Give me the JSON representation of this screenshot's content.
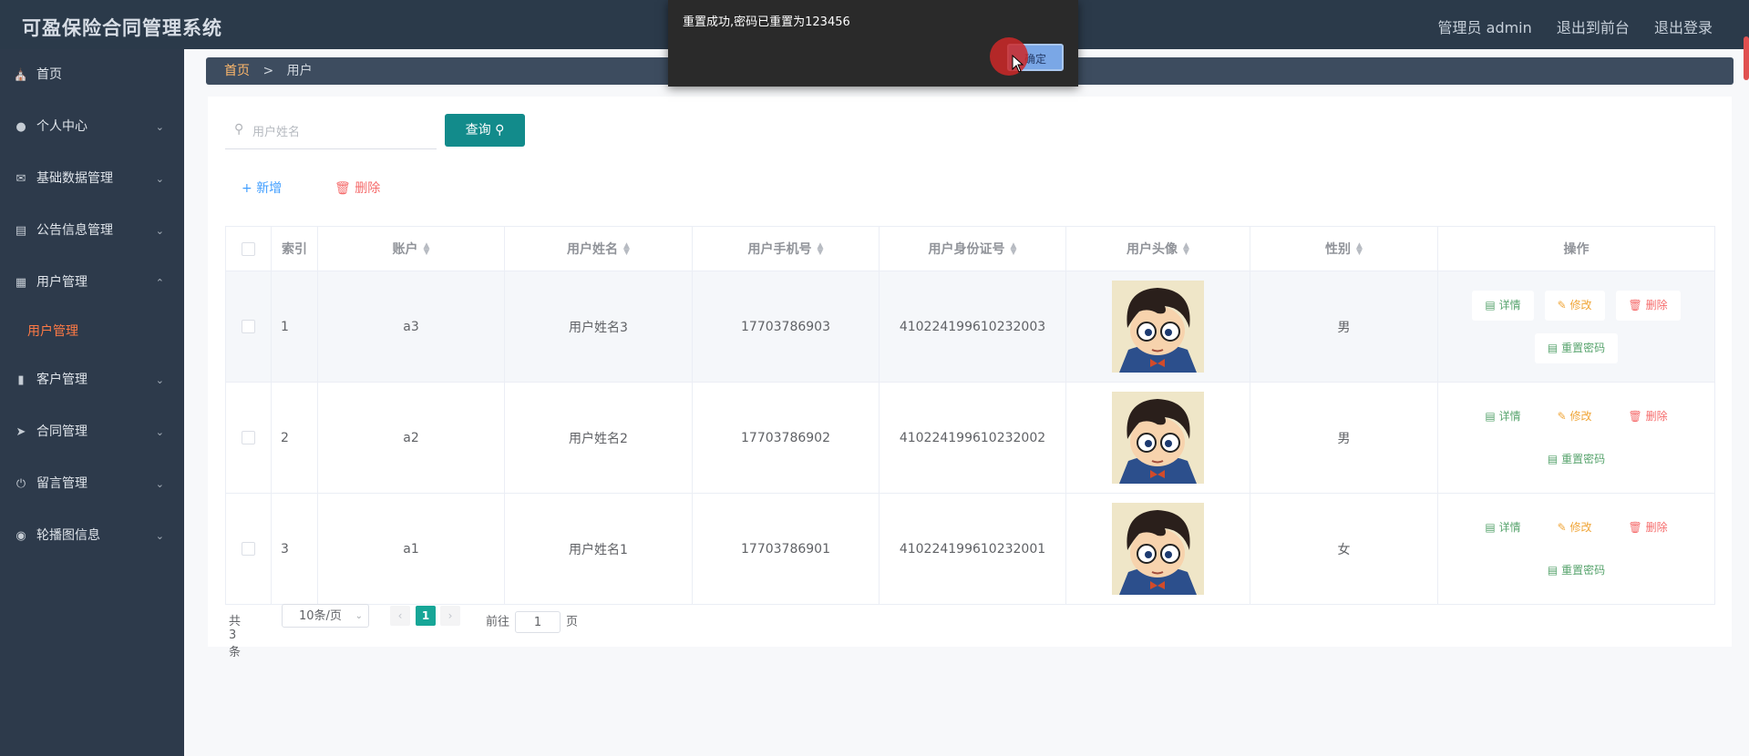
{
  "app": {
    "title": "可盈保险合同管理系统"
  },
  "topbar": {
    "user": "管理员 admin",
    "front": "退出到前台",
    "logout": "退出登录"
  },
  "sidebar": {
    "items": [
      {
        "label": "首页",
        "icon": "home-icon"
      },
      {
        "label": "个人中心",
        "icon": "user-icon"
      },
      {
        "label": "基础数据管理",
        "icon": "mail-icon"
      },
      {
        "label": "公告信息管理",
        "icon": "clipboard-icon"
      },
      {
        "label": "用户管理",
        "icon": "chart-icon",
        "expanded": true
      },
      {
        "label": "客户管理",
        "icon": "stamp-icon"
      },
      {
        "label": "合同管理",
        "icon": "send-icon"
      },
      {
        "label": "留言管理",
        "icon": "power-icon"
      },
      {
        "label": "轮播图信息",
        "icon": "location-icon"
      }
    ],
    "sub_item": "用户管理"
  },
  "breadcrumb": {
    "home": "首页",
    "separator": ">",
    "current": "用户"
  },
  "search": {
    "placeholder": "用户姓名",
    "value": "",
    "button": "查询"
  },
  "actions": {
    "add": "新增",
    "delete": "删除"
  },
  "table": {
    "columns": [
      "索引",
      "账户",
      "用户姓名",
      "用户手机号",
      "用户身份证号",
      "用户头像",
      "性别",
      "操作"
    ],
    "rows": [
      {
        "index": "1",
        "account": "a3",
        "name": "用户姓名3",
        "phone": "17703786903",
        "id_card": "410224199610232003",
        "gender": "男"
      },
      {
        "index": "2",
        "account": "a2",
        "name": "用户姓名2",
        "phone": "17703786902",
        "id_card": "410224199610232002",
        "gender": "男"
      },
      {
        "index": "3",
        "account": "a1",
        "name": "用户姓名1",
        "phone": "17703786901",
        "id_card": "410224199610232001",
        "gender": "女"
      }
    ],
    "ops": {
      "detail": "详情",
      "edit": "修改",
      "delete": "删除",
      "reset": "重置密码"
    }
  },
  "pagination": {
    "total": "共 3 条",
    "page_size": "10条/页",
    "current": "1",
    "goto_label": "前往",
    "goto_value": "1",
    "page_suffix": "页"
  },
  "dialog": {
    "message": "重置成功,密码已重置为123456",
    "ok": "确定"
  }
}
